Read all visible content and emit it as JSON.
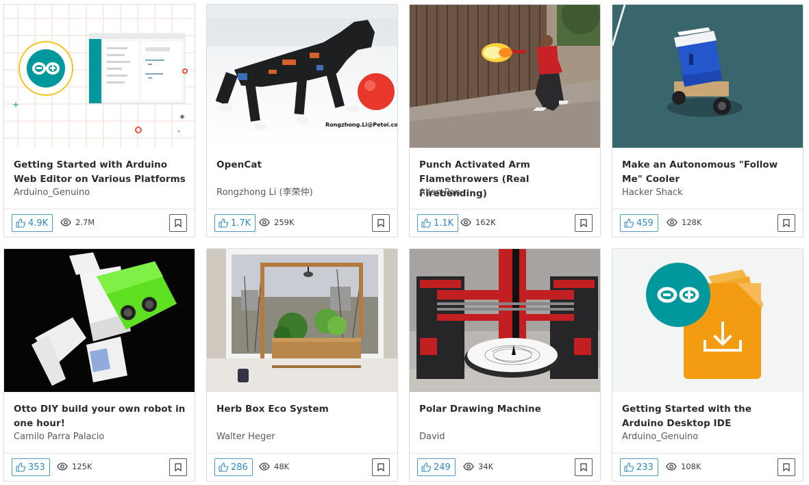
{
  "cards": [
    {
      "title": "Getting Started with Arduino Web Editor on Various Platforms",
      "author": "Arduino_Genuino",
      "respects": "4.9K",
      "views": "2.7M"
    },
    {
      "title": "OpenCat",
      "author": "Rongzhong Li (李荣仲)",
      "respects": "1.7K",
      "views": "259K"
    },
    {
      "title": "Punch Activated Arm Flamethrowers (Real Firebending)",
      "author": "Allen Pan",
      "respects": "1.1K",
      "views": "162K"
    },
    {
      "title": "Make an Autonomous \"Follow Me\" Cooler",
      "author": "Hacker Shack",
      "respects": "459",
      "views": "128K"
    },
    {
      "title": "Otto DIY build your own robot in one hour!",
      "author": "Camilo Parra Palacio",
      "respects": "353",
      "views": "125K"
    },
    {
      "title": "Herb Box Eco System",
      "author": "Walter Heger",
      "respects": "286",
      "views": "48K"
    },
    {
      "title": "Polar Drawing Machine",
      "author": "David",
      "respects": "249",
      "views": "34K"
    },
    {
      "title": "Getting Started with the Arduino Desktop IDE",
      "author": "Arduino_Genuino",
      "respects": "233",
      "views": "108K"
    }
  ],
  "thumbnails": {
    "opencat_watermark": "Rongzhong.Li@Petoi.com"
  },
  "icons": {
    "respect": "thumbs-up-icon",
    "views": "eye-icon",
    "bookmark": "bookmark-icon"
  },
  "colors": {
    "accent": "#2e89bd",
    "arduino_teal": "#00979d"
  }
}
